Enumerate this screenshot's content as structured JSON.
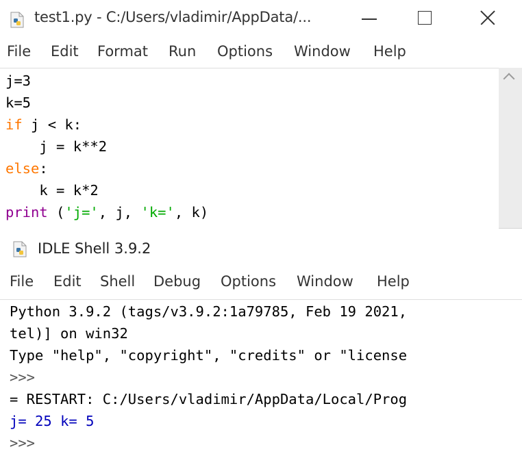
{
  "editor": {
    "title": "test1.py - C:/Users/vladimir/AppData/...",
    "menu": [
      "File",
      "Edit",
      "Format",
      "Run",
      "Options",
      "Window",
      "Help"
    ],
    "code": {
      "l1": "j=3",
      "l2": "k=5",
      "l3_kw": "if",
      "l3_rest": " j < k:",
      "l4": "    j = k**2",
      "l5_kw": "else",
      "l5_rest": ":",
      "l6": "    k = k*2",
      "l7_bi": "print",
      "l7_a": " (",
      "l7_s1": "'j='",
      "l7_b": ", j, ",
      "l7_s2": "'k='",
      "l7_c": ", k)"
    }
  },
  "shell": {
    "title": "IDLE Shell 3.9.2",
    "menu": [
      "File",
      "Edit",
      "Shell",
      "Debug",
      "Options",
      "Window",
      "Help"
    ],
    "lines": {
      "l1": "Python 3.9.2 (tags/v3.9.2:1a79785, Feb 19 2021,",
      "l2": "tel)] on win32",
      "l3": "Type \"help\", \"copyright\", \"credits\" or \"license",
      "l4": ">>>",
      "l5": "= RESTART: C:/Users/vladimir/AppData/Local/Prog",
      "l6_a": "j",
      "l6_b": "= 25 ",
      "l6_c": "k",
      "l6_d": "= 5",
      "l7": ">>>"
    }
  },
  "colors": {
    "keyword": "#ff7700",
    "builtin": "#900090",
    "string": "#00aa00",
    "output": "#0000bb"
  },
  "icons": [
    "python-file-icon",
    "minimize-icon",
    "maximize-icon",
    "close-icon",
    "chevron-up-icon"
  ]
}
